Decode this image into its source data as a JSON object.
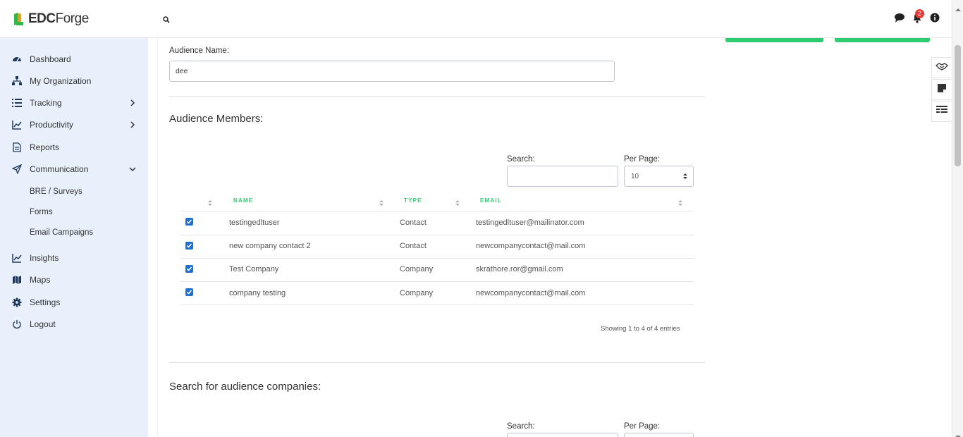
{
  "app": {
    "brand_bold": "EDC",
    "brand_rest": "Forge",
    "notification_count": "2"
  },
  "sidebar": {
    "items": [
      {
        "label": "Dashboard",
        "icon": "dashboard-icon"
      },
      {
        "label": "My Organization",
        "icon": "organization-icon"
      },
      {
        "label": "Tracking",
        "icon": "list-icon",
        "expandable": true
      },
      {
        "label": "Productivity",
        "icon": "chart-line-icon",
        "expandable": true
      },
      {
        "label": "Reports",
        "icon": "report-icon"
      },
      {
        "label": "Communication",
        "icon": "paper-plane-icon",
        "expanded": true
      },
      {
        "label": "Insights",
        "icon": "chart-line-icon"
      },
      {
        "label": "Maps",
        "icon": "map-icon"
      },
      {
        "label": "Settings",
        "icon": "gear-icon"
      },
      {
        "label": "Logout",
        "icon": "power-icon"
      }
    ],
    "sub_items": [
      "BRE / Surveys",
      "Forms",
      "Email Campaigns"
    ]
  },
  "form": {
    "audience_name_label": "Audience Name:",
    "audience_name_value": "dee"
  },
  "members": {
    "title": "Audience Members:",
    "search_label": "Search:",
    "search_value": "",
    "per_page_label": "Per Page:",
    "per_page_value": "10",
    "columns": [
      "NAME",
      "TYPE",
      "EMAIL"
    ],
    "rows": [
      {
        "checked": true,
        "name": "testingedltuser",
        "type": "Contact",
        "email": "testingedltuser@mailinator.com"
      },
      {
        "checked": true,
        "name": "new company contact 2",
        "type": "Contact",
        "email": "newcompanycontact@mail.com"
      },
      {
        "checked": true,
        "name": "Test Company",
        "type": "Company",
        "email": "skrathore.ror@gmail.com"
      },
      {
        "checked": true,
        "name": "company testing",
        "type": "Company",
        "email": "newcompanycontact@mail.com"
      }
    ],
    "showing": "Showing 1 to 4 of 4 entries"
  },
  "companies": {
    "title": "Search for audience companies:",
    "search_label": "Search:",
    "per_page_label": "Per Page:"
  },
  "colors": {
    "accent": "#2ecc71",
    "sidebar_bg": "#e8f1fb",
    "checkbox": "#1f6fd1",
    "badge": "#e53935"
  }
}
